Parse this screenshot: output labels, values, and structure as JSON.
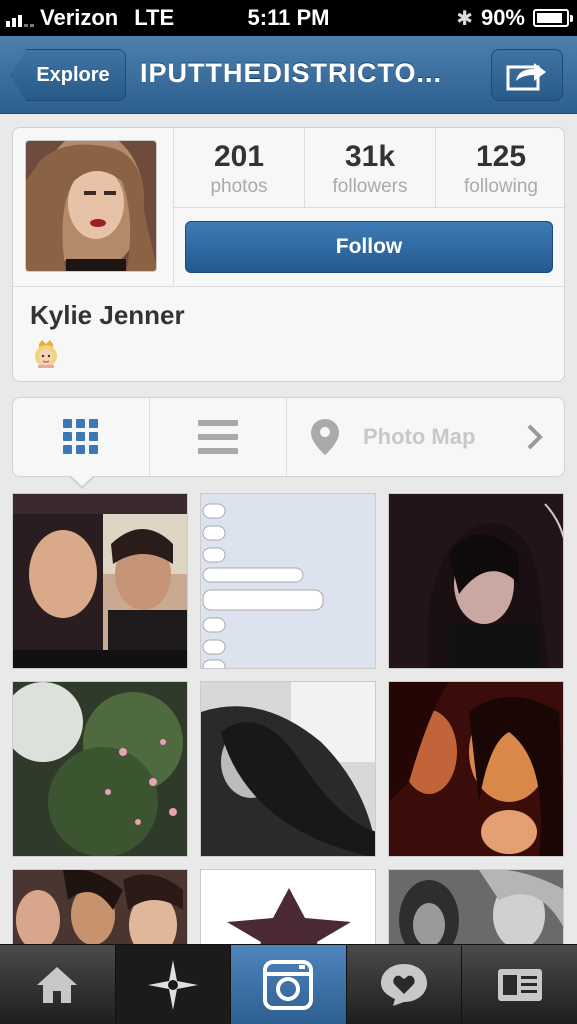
{
  "status_bar": {
    "carrier": "Verizon",
    "network": "LTE",
    "time": "5:11 PM",
    "battery": "90%",
    "battery_level": 0.9
  },
  "nav": {
    "back_label": "Explore",
    "title": "IPUTTHEDISTRICTO...",
    "share_icon": "share-icon"
  },
  "profile": {
    "stats": [
      {
        "value": "201",
        "label": "photos"
      },
      {
        "value": "31k",
        "label": "followers"
      },
      {
        "value": "125",
        "label": "following"
      }
    ],
    "follow_label": "Follow",
    "full_name": "Kylie Jenner",
    "bio_icon": "princess-emoji"
  },
  "view_switcher": {
    "active": "grid",
    "photo_map_label": "Photo Map"
  },
  "photos": [
    {
      "name": "selfie-with-brother"
    },
    {
      "name": "text-messages-screenshot"
    },
    {
      "name": "camera-overlay-selfie"
    },
    {
      "name": "flowers-in-sunlight"
    },
    {
      "name": "black-white-selfie"
    },
    {
      "name": "red-toned-portrait"
    },
    {
      "name": "group-selfie"
    },
    {
      "name": "star-graphic"
    },
    {
      "name": "black-white-duo"
    }
  ],
  "tabs": [
    {
      "name": "home",
      "active": false
    },
    {
      "name": "explore",
      "active": false
    },
    {
      "name": "camera",
      "active": true
    },
    {
      "name": "news",
      "active": false
    },
    {
      "name": "profile",
      "active": false
    }
  ],
  "colors": {
    "nav_blue": "#2c5f8e",
    "follow_blue": "#2d67a1",
    "grid_icon_blue": "#3b78b5"
  }
}
